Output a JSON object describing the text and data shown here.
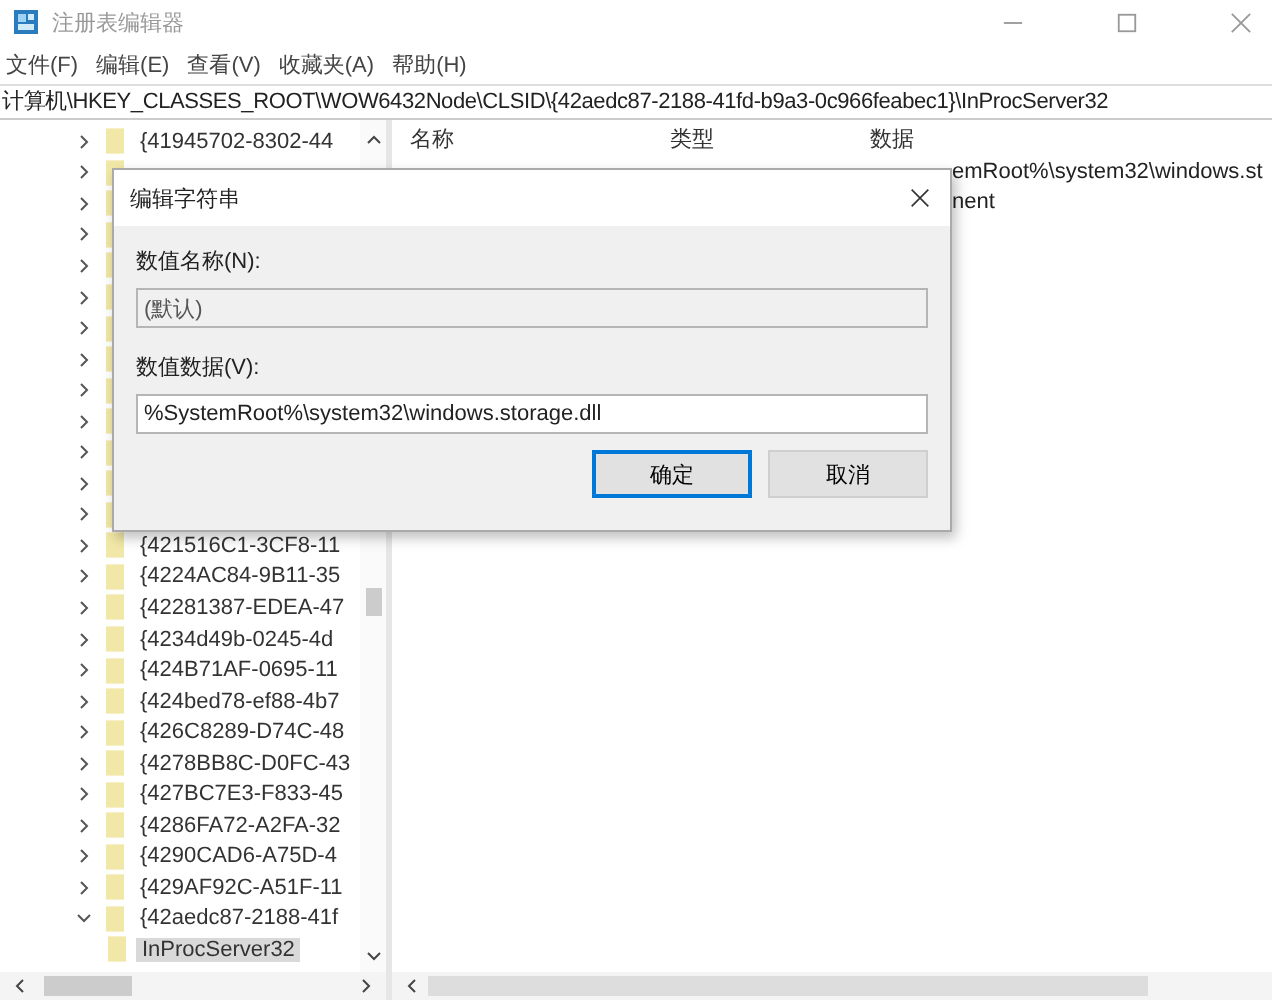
{
  "window": {
    "title": "注册表编辑器"
  },
  "menu": [
    "文件(F)",
    "编辑(E)",
    "查看(V)",
    "收藏夹(A)",
    "帮助(H)"
  ],
  "address": "计算机\\HKEY_CLASSES_ROOT\\WOW6432Node\\CLSID\\{42aedc87-2188-41fd-b9a3-0c966feabec1}\\InProcServer32",
  "tree": [
    {
      "label": "{41945702-8302-44",
      "expanded": false
    },
    {
      "expanded": false
    },
    {
      "expanded": false
    },
    {
      "expanded": false
    },
    {
      "expanded": false
    },
    {
      "expanded": false
    },
    {
      "expanded": false
    },
    {
      "expanded": false
    },
    {
      "expanded": false
    },
    {
      "expanded": false
    },
    {
      "expanded": false
    },
    {
      "expanded": false
    },
    {
      "expanded": false
    },
    {
      "label": "{421516C1-3CF8-11",
      "expanded": false
    },
    {
      "label": "{4224AC84-9B11-35",
      "expanded": false
    },
    {
      "label": "{42281387-EDEA-47",
      "expanded": false
    },
    {
      "label": "{4234d49b-0245-4d",
      "expanded": false
    },
    {
      "label": "{424B71AF-0695-11",
      "expanded": false
    },
    {
      "label": "{424bed78-ef88-4b7",
      "expanded": false
    },
    {
      "label": "{426C8289-D74C-48",
      "expanded": false
    },
    {
      "label": "{4278BB8C-D0FC-43",
      "expanded": false
    },
    {
      "label": "{427BC7E3-F833-45",
      "expanded": false
    },
    {
      "label": "{4286FA72-A2FA-32",
      "expanded": false
    },
    {
      "label": "{4290CAD6-A75D-4",
      "expanded": false
    },
    {
      "label": "{429AF92C-A51F-11",
      "expanded": false
    },
    {
      "label": "{42aedc87-2188-41f",
      "expanded": true,
      "children": [
        {
          "label": "InProcServer32",
          "selected": true
        }
      ]
    }
  ],
  "values": {
    "columns": [
      "名称",
      "类型",
      "数据"
    ],
    "rows": [
      {
        "data": "emRoot%\\system32\\windows.st"
      },
      {
        "data": "nent"
      }
    ]
  },
  "dialog": {
    "title": "编辑字符串",
    "name_label": "数值名称(N):",
    "name_value": "(默认)",
    "data_label": "数值数据(V):",
    "data_value": "%SystemRoot%\\system32\\windows.storage.dll",
    "buttons": [
      {
        "label": "确定",
        "default": true
      },
      {
        "label": "取消",
        "default": false
      }
    ]
  }
}
